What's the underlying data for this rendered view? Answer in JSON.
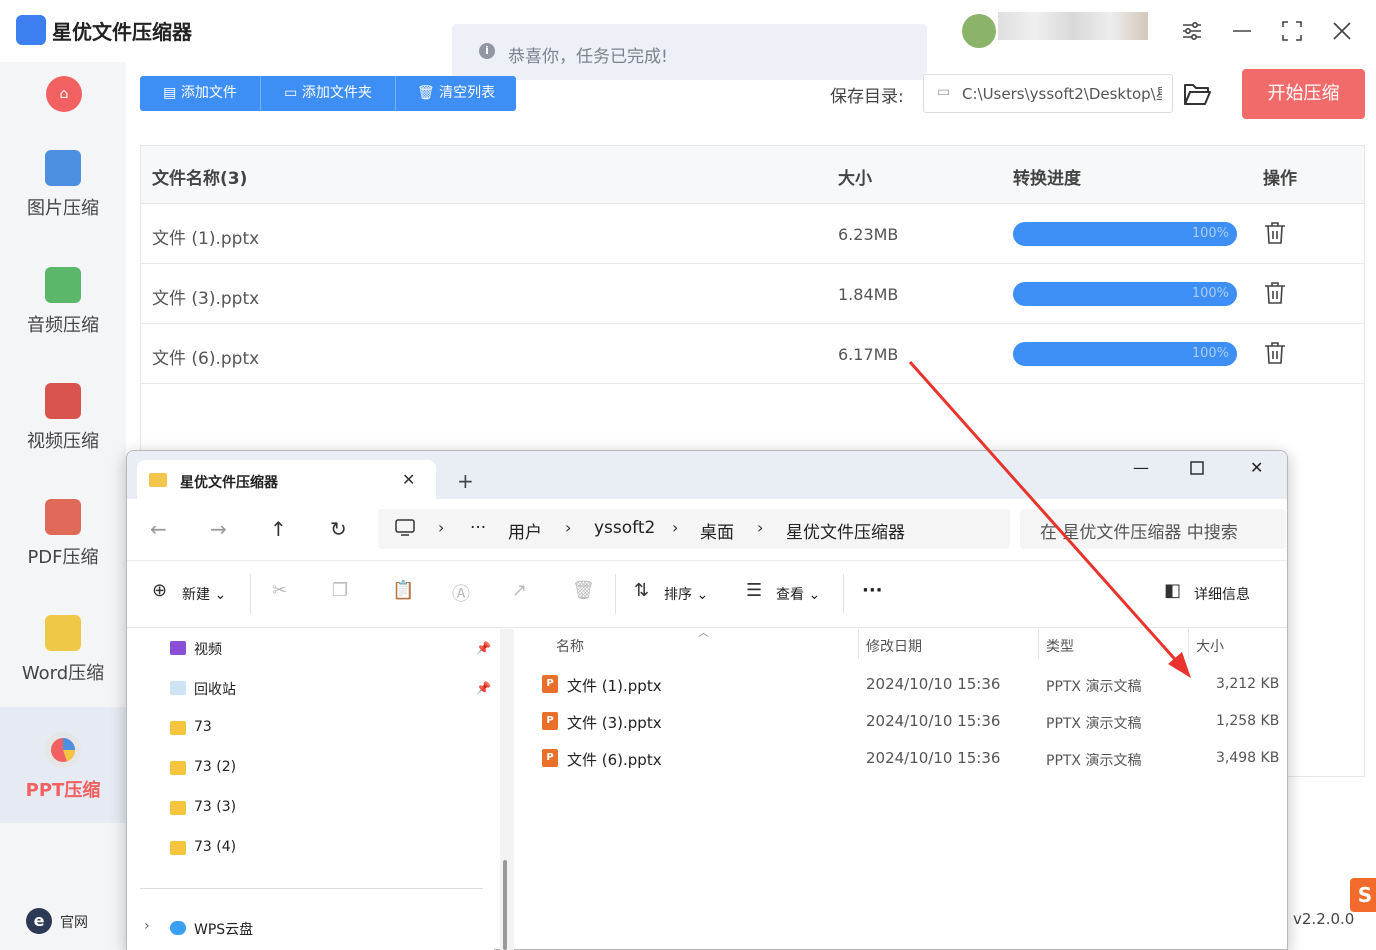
{
  "app": {
    "title": "星优文件压缩器",
    "window_controls": {
      "settings": "⚙",
      "minimize": "—",
      "maximize": "⛶",
      "close": "✕"
    }
  },
  "toast": {
    "text": "恭喜你，任务已完成!",
    "icon": "i"
  },
  "sidebar": {
    "items": [
      {
        "label": "图片压缩",
        "icon": "image-icon"
      },
      {
        "label": "音频压缩",
        "icon": "audio-icon"
      },
      {
        "label": "视频压缩",
        "icon": "video-icon"
      },
      {
        "label": "PDF压缩",
        "icon": "pdf-icon"
      },
      {
        "label": "Word压缩",
        "icon": "word-icon"
      },
      {
        "label": "PPT压缩",
        "icon": "ppt-icon",
        "active": true
      }
    ],
    "site_label": "官网",
    "site_icon": "e"
  },
  "toolbar": {
    "add_file": "添加文件",
    "add_folder": "添加文件夹",
    "clear_list": "清空列表",
    "save_dir_label": "保存目录:",
    "save_dir_value": "C:\\Users\\yssoft2\\Desktop\\星",
    "start_button": "开始压缩"
  },
  "table": {
    "headers": [
      "文件名称(3)",
      "大小",
      "转换进度",
      "操作"
    ],
    "rows": [
      {
        "name": "文件 (1).pptx",
        "size": "6.23MB",
        "progress": 100,
        "progress_label": "100%"
      },
      {
        "name": "文件 (3).pptx",
        "size": "1.84MB",
        "progress": 100,
        "progress_label": "100%"
      },
      {
        "name": "文件 (6).pptx",
        "size": "6.17MB",
        "progress": 100,
        "progress_label": "100%"
      }
    ]
  },
  "version": "v2.2.0.0",
  "explorer": {
    "tab_title": "星优文件压缩器",
    "breadcrumb": [
      "用户",
      "yssoft2",
      "桌面",
      "星优文件压缩器"
    ],
    "breadcrumb_more": "···",
    "search_placeholder": "在 星优文件压缩器 中搜索",
    "commands": {
      "new": "新建",
      "sort": "排序",
      "view": "查看",
      "more": "···",
      "details": "详细信息"
    },
    "nav_items": [
      {
        "label": "视频",
        "pinned": true
      },
      {
        "label": "回收站",
        "pinned": true
      },
      {
        "label": "73"
      },
      {
        "label": "73 (2)"
      },
      {
        "label": "73 (3)"
      },
      {
        "label": "73 (4)"
      },
      {
        "label": "WPS云盘"
      }
    ],
    "columns": [
      "名称",
      "修改日期",
      "类型",
      "大小"
    ],
    "files": [
      {
        "name": "文件 (1).pptx",
        "date": "2024/10/10 15:36",
        "type": "PPTX 演示文稿",
        "size": "3,212 KB"
      },
      {
        "name": "文件 (3).pptx",
        "date": "2024/10/10 15:36",
        "type": "PPTX 演示文稿",
        "size": "1,258 KB"
      },
      {
        "name": "文件 (6).pptx",
        "date": "2024/10/10 15:36",
        "type": "PPTX 演示文稿",
        "size": "3,498 KB"
      }
    ]
  },
  "colors": {
    "accent_blue": "#3d8ef5",
    "accent_red": "#f26b6b",
    "arrow_red": "#e8342c"
  }
}
